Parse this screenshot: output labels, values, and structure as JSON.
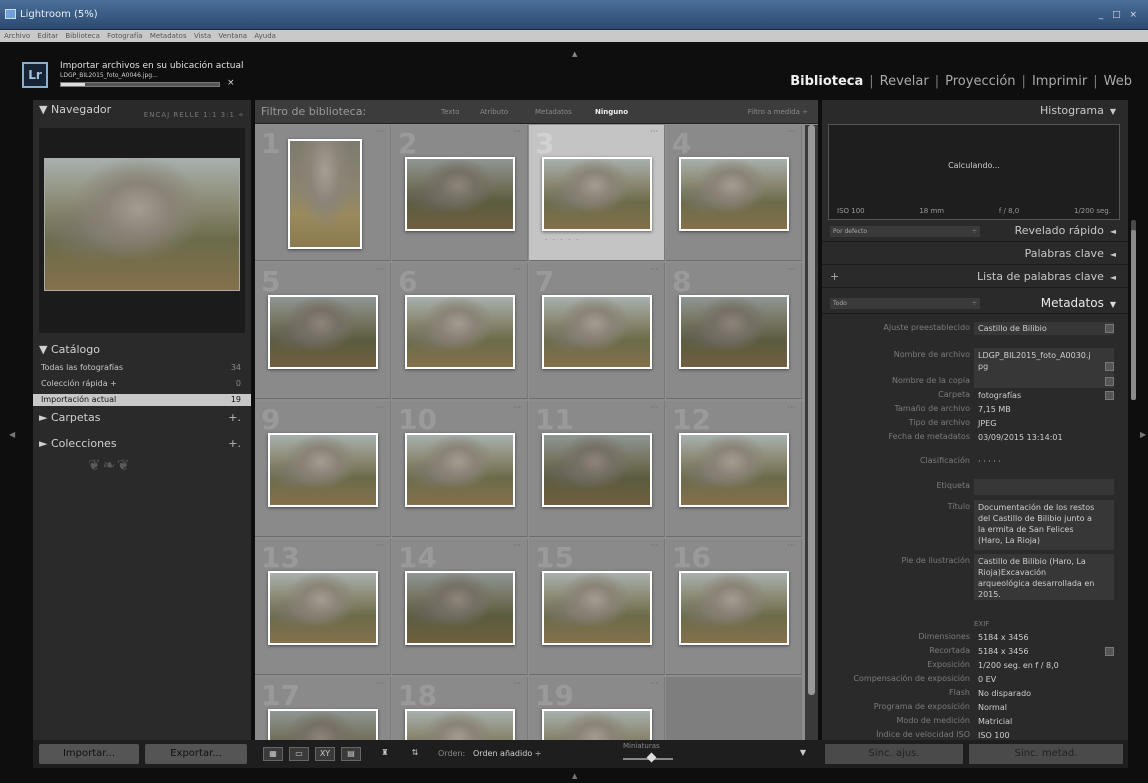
{
  "window": {
    "title": "Lightroom (5%)",
    "controls": "_ □ ×"
  },
  "menubar": {
    "items": [
      "Archivo",
      "Editar",
      "Biblioteca",
      "Fotografía",
      "Metadatos",
      "Vista",
      "Ventana",
      "Ayuda"
    ]
  },
  "identity": {
    "logo": "Lr",
    "import_title": "Importar archivos en su ubicación actual",
    "import_file": "LDGP_BIL2015_foto_A0046.jpg...",
    "import_progress": 0.15,
    "cancel": "×"
  },
  "modules": [
    "Biblioteca",
    "Revelar",
    "Proyección",
    "Imprimir",
    "Web"
  ],
  "navigator": {
    "title": "Navegador",
    "options": "ENCAJ  RELLE  1:1  3:1 ÷"
  },
  "catalog": {
    "title": "Catálogo",
    "rows": [
      {
        "label": "Todas las fotografías",
        "count": "34"
      },
      {
        "label": "Colección rápida +",
        "count": "0"
      },
      {
        "label": "Importación actual",
        "count": "19"
      }
    ]
  },
  "folders": {
    "title": "Carpetas",
    "plus": "+."
  },
  "collections": {
    "title": "Colecciones",
    "plus": "+."
  },
  "ornament": "❦❧❦",
  "filter": {
    "label": "Filtro de biblioteca:",
    "tabs": [
      "Texto",
      "Atributo",
      "Metadatos",
      "Ninguno"
    ],
    "preset": "Filtro a medida ÷"
  },
  "grid": {
    "cells": [
      "1",
      "2",
      "3",
      "4",
      "5",
      "6",
      "7",
      "8",
      "9",
      "10",
      "11",
      "12",
      "13",
      "14",
      "15",
      "16",
      "17",
      "18",
      "19"
    ],
    "dots": "···",
    "stars": "· · · · ·",
    "rotate_left": "↶",
    "rotate_right": "↷"
  },
  "right": {
    "histogram": {
      "title": "Histograma",
      "calculating": "Calculando...",
      "iso": "ISO 100",
      "focal": "18 mm",
      "aperture": "f / 8,0",
      "shutter": "1/200 seg."
    },
    "quick_develop": {
      "title": "Revelado rápido",
      "preset": "Por defecto"
    },
    "keywords": {
      "title": "Palabras clave"
    },
    "keyword_list": {
      "title": "Lista de palabras clave",
      "plus": "+"
    },
    "metadata": {
      "title": "Metadatos",
      "preset": "Todo",
      "preset_label": "Ajuste preestablecido",
      "preset_value": "Castillo de Bilibio",
      "rows": [
        {
          "label": "Nombre de archivo",
          "value": "LDGP_BIL2015_foto_A0030.j pg"
        },
        {
          "label": "Nombre de la copia",
          "value": ""
        },
        {
          "label": "Carpeta",
          "value": "fotografías"
        },
        {
          "label": "Tamaño de archivo",
          "value": "7,15 MB"
        },
        {
          "label": "Tipo de archivo",
          "value": "JPEG"
        },
        {
          "label": "Fecha de metadatos",
          "value": "03/09/2015 13:14:01"
        },
        {
          "label": "Clasificación",
          "value": "· · · · ·"
        },
        {
          "label": "Etiqueta",
          "value": ""
        },
        {
          "label": "Título",
          "value": "Documentación de los restos del Castillo de Bilibio junto a la ermita de San Felices (Haro, La Rioja)"
        },
        {
          "label": "Pie de ilustración",
          "value": "Castillo de Bilibio (Haro, La Rioja)Excavación arqueológica desarrollada en 2015."
        }
      ],
      "exif_header": "EXIF",
      "exif": [
        {
          "label": "Dimensiones",
          "value": "5184 x 3456"
        },
        {
          "label": "Recortada",
          "value": "5184 x 3456"
        },
        {
          "label": "Exposición",
          "value": "1/200 seg. en f / 8,0"
        },
        {
          "label": "Compensación de exposición",
          "value": "0 EV"
        },
        {
          "label": "Flash",
          "value": "No disparado"
        },
        {
          "label": "Programa de exposición",
          "value": "Normal"
        },
        {
          "label": "Modo de medición",
          "value": "Matricial"
        },
        {
          "label": "Índice de velocidad ISO",
          "value": "ISO 100"
        }
      ]
    }
  },
  "bottom": {
    "import": "Importar...",
    "export": "Exportar...",
    "sort_label": "Orden:",
    "sort_value": "Orden añadido ÷",
    "thumbs_label": "Miniaturas",
    "sync_settings": "Sinc. ajus.",
    "sync_metadata": "Sinc. metad."
  }
}
